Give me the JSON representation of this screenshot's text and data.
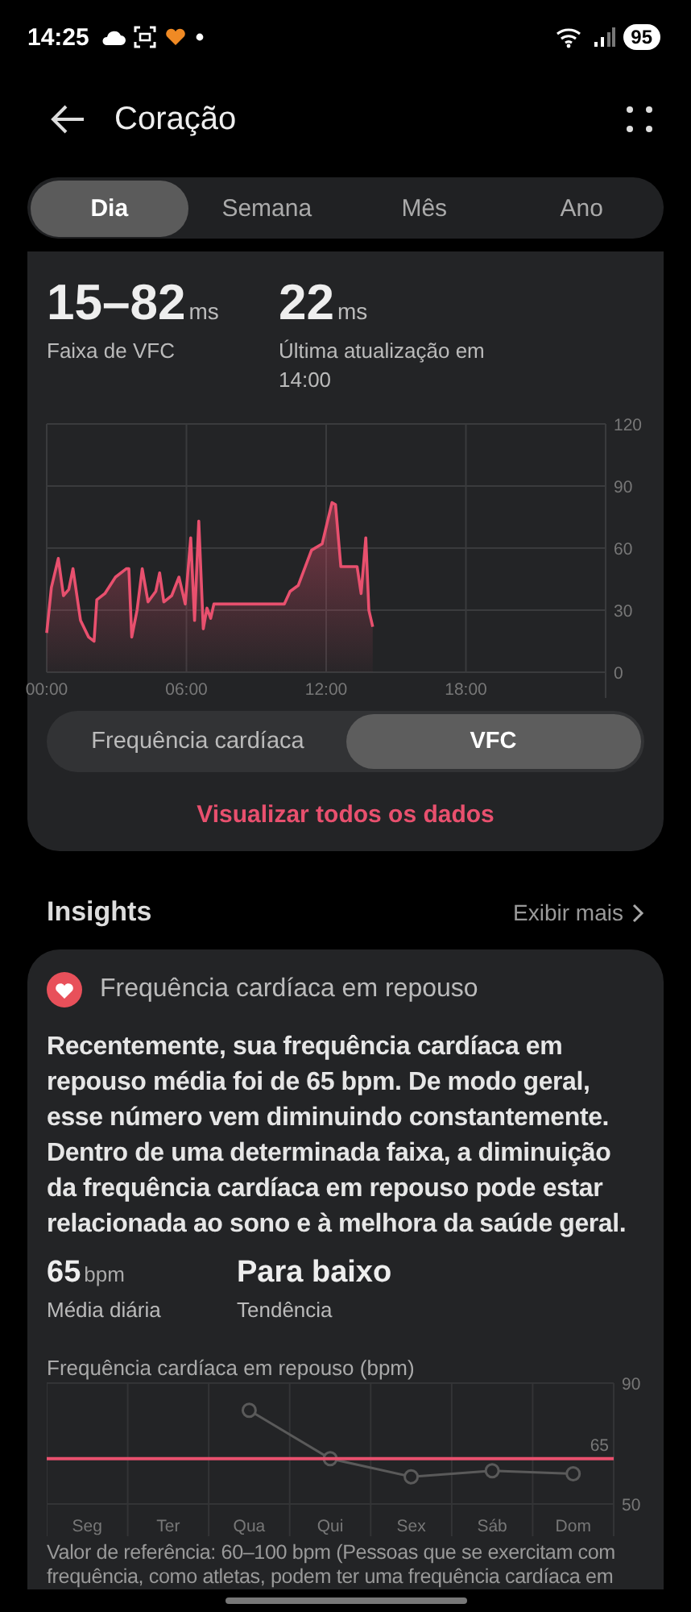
{
  "status_bar": {
    "time": "14:25",
    "battery": "95"
  },
  "header": {
    "title": "Coração"
  },
  "tabs": [
    {
      "label": "Dia",
      "selected": true
    },
    {
      "label": "Semana",
      "selected": false
    },
    {
      "label": "Mês",
      "selected": false
    },
    {
      "label": "Ano",
      "selected": false
    }
  ],
  "hrv_card": {
    "stats": [
      {
        "value": "15–82",
        "unit": "ms",
        "label": "Faixa de VFC"
      },
      {
        "value": "22",
        "unit": "ms",
        "label": "Última atualização em 14:00"
      }
    ],
    "chart_data": {
      "type": "area",
      "xlim": [
        0,
        24
      ],
      "ylim": [
        0,
        120
      ],
      "xticks": [
        {
          "value": 0,
          "label": "00:00"
        },
        {
          "value": 6,
          "label": "06:00"
        },
        {
          "value": 12,
          "label": "12:00"
        },
        {
          "value": 18,
          "label": "18:00"
        }
      ],
      "yticks": [
        0,
        30,
        60,
        90,
        120
      ],
      "x": [
        0,
        0.2,
        0.5,
        0.72,
        0.95,
        1.13,
        1.45,
        1.8,
        2.03,
        2.15,
        2.5,
        2.95,
        3.42,
        3.53,
        3.65,
        3.88,
        4.1,
        4.35,
        4.68,
        4.85,
        5.03,
        5.37,
        5.68,
        5.95,
        6.18,
        6.35,
        6.53,
        6.72,
        6.88,
        7.04,
        7.18,
        10.2,
        10.45,
        10.8,
        11.37,
        11.83,
        12.25,
        12.4,
        12.63,
        13.33,
        13.5,
        13.7,
        13.83,
        14.0
      ],
      "grid": true,
      "series": [
        {
          "color": "#e8506e",
          "values": [
            19,
            41,
            55,
            37,
            40,
            50,
            25,
            17,
            15,
            35,
            38,
            46,
            50,
            50,
            17,
            30,
            50,
            34,
            39,
            48,
            34,
            37,
            46,
            33,
            65,
            25,
            73,
            21,
            31,
            26,
            33,
            33,
            39,
            42,
            59,
            62,
            82,
            81,
            51,
            51,
            38,
            65,
            30,
            22
          ]
        }
      ]
    },
    "toggle": [
      {
        "label": "Frequência cardíaca",
        "selected": false
      },
      {
        "label": "VFC",
        "selected": true
      }
    ],
    "link": "Visualizar todos os dados"
  },
  "insights": {
    "title": "Insights",
    "more": "Exibir mais",
    "card": {
      "title": "Frequência cardíaca em repouso",
      "text": "Recentemente, sua frequência cardíaca em repouso média foi de 65 bpm. De modo geral, esse número vem diminuindo constantemente. Dentro de uma determinada faixa, a diminuição da frequência cardíaca em repouso pode estar relacionada ao sono e à melhora da saúde geral.",
      "stats": [
        {
          "value": "65",
          "unit": "bpm",
          "label": "Média diária"
        },
        {
          "value": "Para baixo",
          "label": "Tendência"
        }
      ],
      "chart_data": {
        "type": "line",
        "title": "Frequência cardíaca em repouso (bpm)",
        "categories": [
          "Seg",
          "Ter",
          "Qua",
          "Qui",
          "Sex",
          "Sáb",
          "Dom"
        ],
        "ylim": [
          50,
          90
        ],
        "yticks": [
          50,
          90
        ],
        "grid": true,
        "series": [
          {
            "color": "#5a5a5a",
            "marker": "o",
            "values": [
              null,
              null,
              81,
              65,
              59,
              61,
              60
            ]
          }
        ],
        "ref_lines": [
          {
            "axis": "y",
            "value": 65,
            "label": "65",
            "color": "#e8506e"
          }
        ]
      },
      "reference": "Valor de referência: 60–100 bpm (Pessoas que se exercitam com frequência, como atletas, podem ter uma frequência cardíaca em"
    }
  }
}
